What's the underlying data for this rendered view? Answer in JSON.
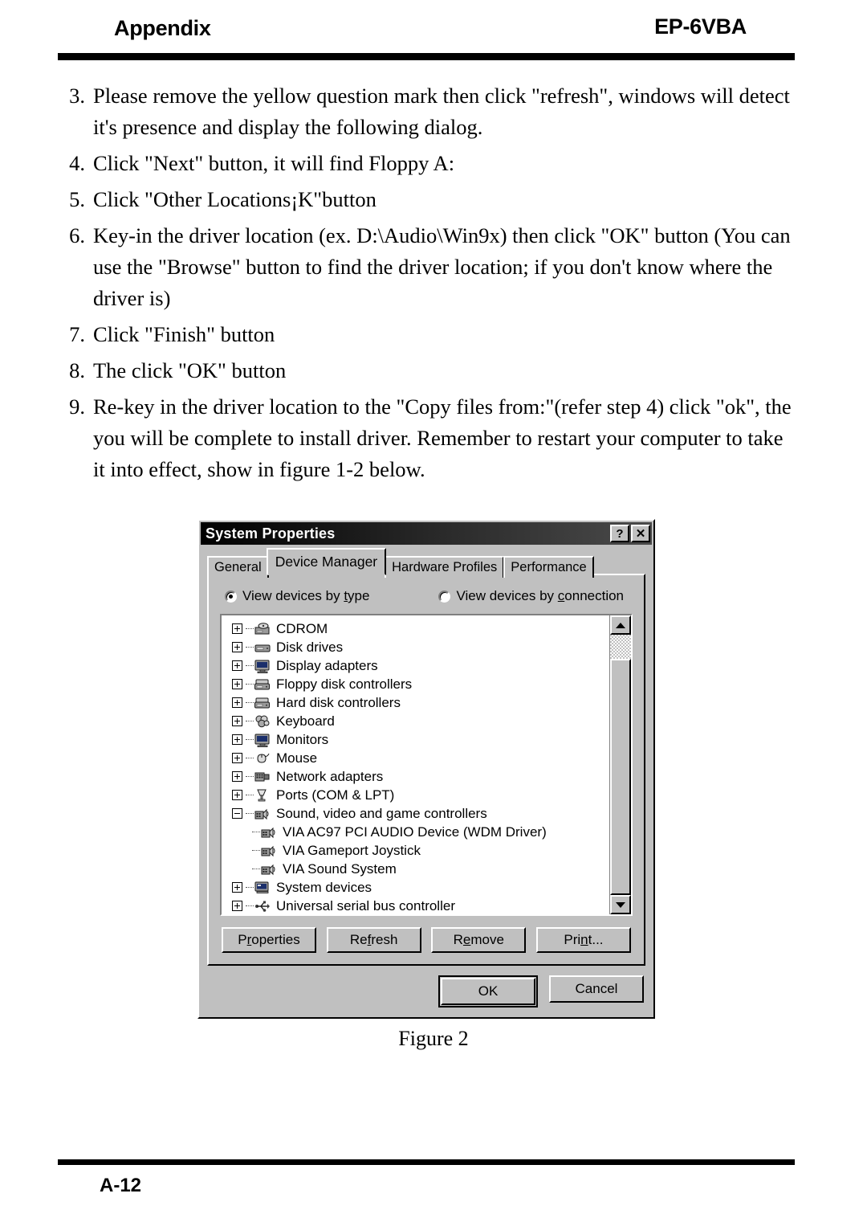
{
  "header": {
    "left_title": "Appendix",
    "right_title": "EP-6VBA"
  },
  "steps": [
    {
      "num": "3.",
      "text": "Please remove the yellow question mark then click \"refresh\", windows will detect it's presence and display the following dialog."
    },
    {
      "num": "4.",
      "text": "Click \"Next\" button, it will find Floppy A:"
    },
    {
      "num": "5.",
      "text": "Click \"Other Locations¡K\"button"
    },
    {
      "num": "6.",
      "text": "Key-in the driver location (ex. D:\\Audio\\Win9x) then click \"OK\" button (You can use the \"Browse\" button to find the driver location; if you don't know where the driver is)"
    },
    {
      "num": "7.",
      "text": "Click \"Finish\" button"
    },
    {
      "num": "8.",
      "text": "The click \"OK\" button"
    },
    {
      "num": "9.",
      "text": "Re-key in the driver location to the \"Copy files from:\"(refer step 4) click \"ok\", the you will be complete to install driver. Remember to restart your computer to take it into effect, show in figure 1-2 below."
    }
  ],
  "dialog": {
    "title": "System Properties",
    "help_button": "?",
    "close_button": "✕",
    "tabs": [
      {
        "label": "General",
        "active": false
      },
      {
        "label": "Device Manager",
        "active": true
      },
      {
        "label": "Hardware Profiles",
        "active": false
      },
      {
        "label": "Performance",
        "active": false
      }
    ],
    "radios": [
      {
        "label_pre": "View devices by ",
        "accel": "t",
        "label_post": "ype",
        "selected": true
      },
      {
        "label_pre": "View devices by ",
        "accel": "c",
        "label_post": "onnection",
        "selected": false
      }
    ],
    "tree": [
      {
        "label": "CDROM",
        "level": 0,
        "expander": "plus",
        "icon": "cdrom-icon"
      },
      {
        "label": "Disk drives",
        "level": 0,
        "expander": "plus",
        "icon": "disk-drive-icon"
      },
      {
        "label": "Display adapters",
        "level": 0,
        "expander": "plus",
        "icon": "monitor-icon"
      },
      {
        "label": "Floppy disk controllers",
        "level": 0,
        "expander": "plus",
        "icon": "controller-icon"
      },
      {
        "label": "Hard disk controllers",
        "level": 0,
        "expander": "plus",
        "icon": "controller-icon"
      },
      {
        "label": "Keyboard",
        "level": 0,
        "expander": "plus",
        "icon": "keyboard-icon"
      },
      {
        "label": "Monitors",
        "level": 0,
        "expander": "plus",
        "icon": "monitor-icon"
      },
      {
        "label": "Mouse",
        "level": 0,
        "expander": "plus",
        "icon": "mouse-icon"
      },
      {
        "label": "Network adapters",
        "level": 0,
        "expander": "plus",
        "icon": "network-card-icon"
      },
      {
        "label": "Ports (COM & LPT)",
        "level": 0,
        "expander": "plus",
        "icon": "port-icon"
      },
      {
        "label": "Sound, video and game controllers",
        "level": 0,
        "expander": "minus",
        "icon": "sound-icon"
      },
      {
        "label": "VIA AC97 PCI AUDIO Device (WDM Driver)",
        "level": 1,
        "expander": "none",
        "icon": "sound-icon"
      },
      {
        "label": "VIA Gameport Joystick",
        "level": 1,
        "expander": "none",
        "icon": "sound-icon"
      },
      {
        "label": "VIA Sound System",
        "level": 1,
        "expander": "none",
        "icon": "sound-icon"
      },
      {
        "label": "System devices",
        "level": 0,
        "expander": "plus",
        "icon": "computer-icon"
      },
      {
        "label": "Universal serial bus controller",
        "level": 0,
        "expander": "plus",
        "icon": "usb-icon"
      }
    ],
    "action_buttons": [
      {
        "pre": "P",
        "accel": "r",
        "post": "operties"
      },
      {
        "pre": "Re",
        "accel": "f",
        "post": "resh"
      },
      {
        "pre": "R",
        "accel": "e",
        "post": "move"
      },
      {
        "pre": "Pri",
        "accel": "n",
        "post": "t..."
      }
    ],
    "ok_label": "OK",
    "cancel_label": "Cancel"
  },
  "figure_caption": "Figure 2",
  "footer": {
    "page_number": "A-12"
  }
}
